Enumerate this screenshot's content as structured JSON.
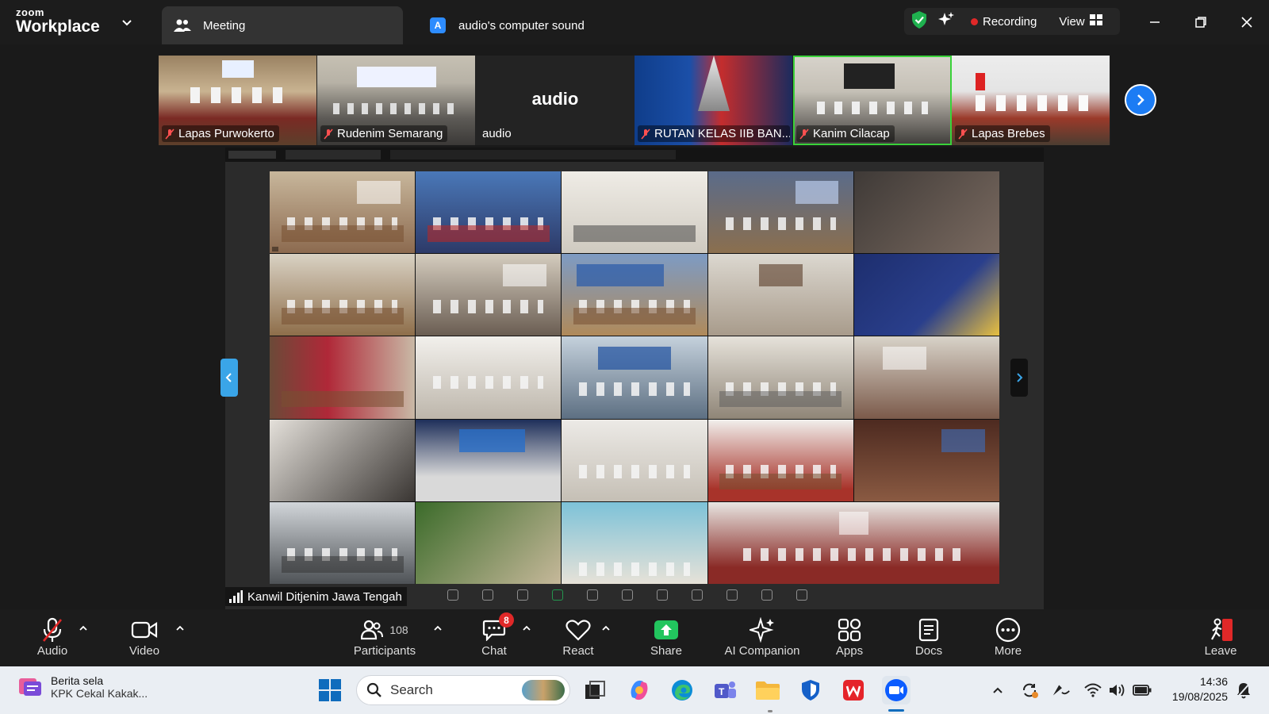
{
  "titlebar": {
    "brand_top": "zoom",
    "brand_bottom": "Workplace",
    "tabs": [
      {
        "label": "Meeting",
        "icon": "participants-icon"
      },
      {
        "label": "audio's computer sound",
        "badge": "A"
      }
    ],
    "status": {
      "recording_label": "Recording",
      "view_label": "View"
    }
  },
  "strip": {
    "tiles": [
      {
        "name": "Lapas Purwokerto",
        "muted": true
      },
      {
        "name": "Rudenim Semarang",
        "muted": true
      },
      {
        "name": "audio",
        "muted": false,
        "big_label": "audio"
      },
      {
        "name": "RUTAN KELAS IIB BAN...",
        "muted": true
      },
      {
        "name": "Kanim Cilacap",
        "muted": true
      },
      {
        "name": "Lapas Brebes",
        "muted": true
      }
    ]
  },
  "share": {
    "speaker_label": "Kanwil Ditjenim Jawa Tengah"
  },
  "controls": {
    "audio": "Audio",
    "video": "Video",
    "participants": "Participants",
    "participants_count": "108",
    "chat": "Chat",
    "chat_badge": "8",
    "react": "React",
    "share": "Share",
    "ai_companion": "AI Companion",
    "apps": "Apps",
    "docs": "Docs",
    "more": "More",
    "leave": "Leave"
  },
  "taskbar": {
    "news_title": "Berita sela",
    "news_sub": "KPK Cekal Kakak...",
    "search_placeholder": "Search",
    "time": "14:36",
    "date": "19/08/2025"
  },
  "colors": {
    "accent_blue": "#2d8cff",
    "recording_red": "#e02828",
    "share_green": "#22c55e",
    "shield_green": "#1fb14f"
  }
}
